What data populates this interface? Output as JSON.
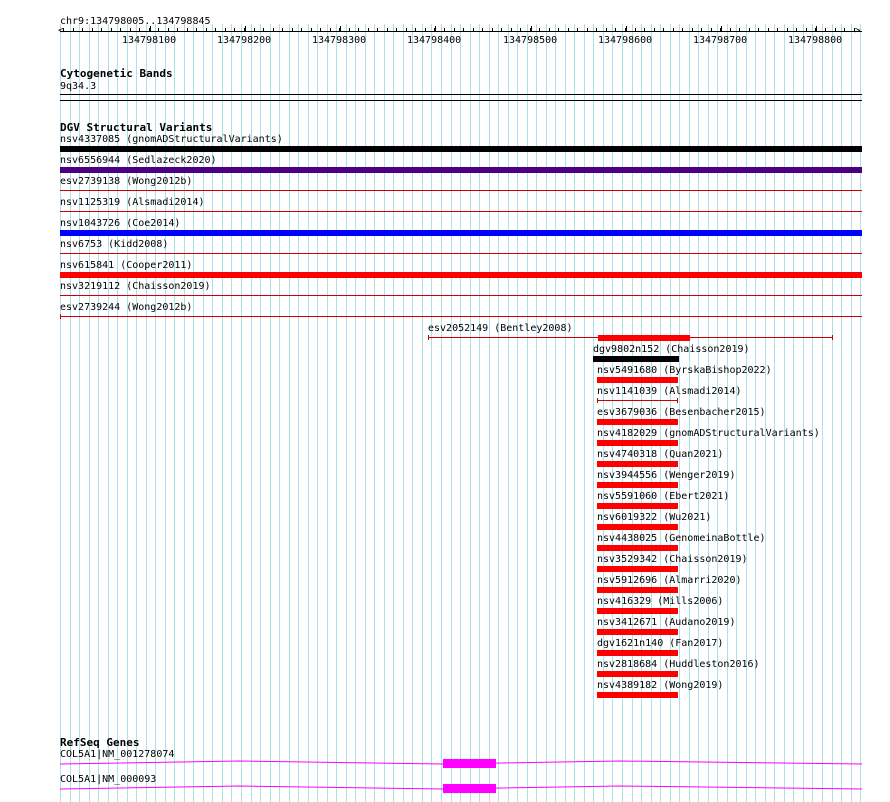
{
  "ruler": {
    "location": "chr9:134798005..134798845",
    "labels": [
      "134798100",
      "134798200",
      "134798300",
      "134798400",
      "134798500",
      "134798600",
      "134798700",
      "134798800"
    ]
  },
  "cytobands": {
    "title": "Cytogenetic Bands",
    "band": "9q34.3"
  },
  "dgv": {
    "title": "DGV Structural Variants",
    "rows": [
      {
        "label": "nsv4337085 (gnomADStructuralVariants)",
        "color": "#000000",
        "kind": "bar"
      },
      {
        "label": "nsv6556944 (Sedlazeck2020)",
        "color": "#4b0082",
        "kind": "bar"
      },
      {
        "label": "esv2739138 (Wong2012b)",
        "color": "#cc0000",
        "kind": "thin"
      },
      {
        "label": "nsv1125319 (Alsmadi2014)",
        "color": "#cc0000",
        "kind": "thin"
      },
      {
        "label": "nsv1043726 (Coe2014)",
        "color": "#0000ff",
        "kind": "bar"
      },
      {
        "label": "nsv6753 (Kidd2008)",
        "color": "#cc0000",
        "kind": "thin"
      },
      {
        "label": "nsv615841 (Cooper2011)",
        "color": "#ff0000",
        "kind": "bar"
      },
      {
        "label": "nsv3219112 (Chaisson2019)",
        "color": "#cc0000",
        "kind": "thin"
      },
      {
        "label": "esv2739244 (Wong2012b)",
        "color": "#cc0000",
        "kind": "thin"
      }
    ],
    "partial": [
      {
        "label": "esv2052149 (Bentley2008)",
        "color": "#cc0000",
        "kind": "thin-bar"
      },
      {
        "label": "dgv9802n152 (Chaisson2019)",
        "color": "#000000",
        "kind": "bar"
      },
      {
        "label": "nsv5491680 (ByrskaBishop2022)",
        "color": "#ff0000",
        "kind": "bar"
      },
      {
        "label": "nsv1141039 (Alsmadi2014)",
        "color": "#cc0000",
        "kind": "thin"
      },
      {
        "label": "esv3679036 (Besenbacher2015)",
        "color": "#ff0000",
        "kind": "bar"
      },
      {
        "label": "nsv4182029 (gnomADStructuralVariants)",
        "color": "#ff0000",
        "kind": "bar"
      },
      {
        "label": "nsv4740318 (Quan2021)",
        "color": "#ff0000",
        "kind": "bar"
      },
      {
        "label": "nsv3944556 (Wenger2019)",
        "color": "#ff0000",
        "kind": "bar"
      },
      {
        "label": "nsv5591060 (Ebert2021)",
        "color": "#ff0000",
        "kind": "bar"
      },
      {
        "label": "nsv6019322 (Wu2021)",
        "color": "#ff0000",
        "kind": "bar"
      },
      {
        "label": "nsv4438025 (GenomeinaBottle)",
        "color": "#ff0000",
        "kind": "bar"
      },
      {
        "label": "nsv3529342 (Chaisson2019)",
        "color": "#ff0000",
        "kind": "bar"
      },
      {
        "label": "nsv5912696 (Almarri2020)",
        "color": "#ff0000",
        "kind": "bar"
      },
      {
        "label": "nsv416329 (Mills2006)",
        "color": "#ff0000",
        "kind": "bar"
      },
      {
        "label": "nsv3412671 (Audano2019)",
        "color": "#ff0000",
        "kind": "bar"
      },
      {
        "label": "dgv1621n140 (Fan2017)",
        "color": "#ff0000",
        "kind": "bar"
      },
      {
        "label": "nsv2818684 (Huddleston2016)",
        "color": "#ff0000",
        "kind": "bar"
      },
      {
        "label": "nsv4389182 (Wong2019)",
        "color": "#ff0000",
        "kind": "bar"
      }
    ]
  },
  "refseq": {
    "title": "RefSeq Genes",
    "genes": [
      {
        "label": "COL5A1|NM_001278074",
        "color": "#ff00ff"
      },
      {
        "label": "COL5A1|NM_000093",
        "color": "#ff00ff"
      }
    ]
  }
}
